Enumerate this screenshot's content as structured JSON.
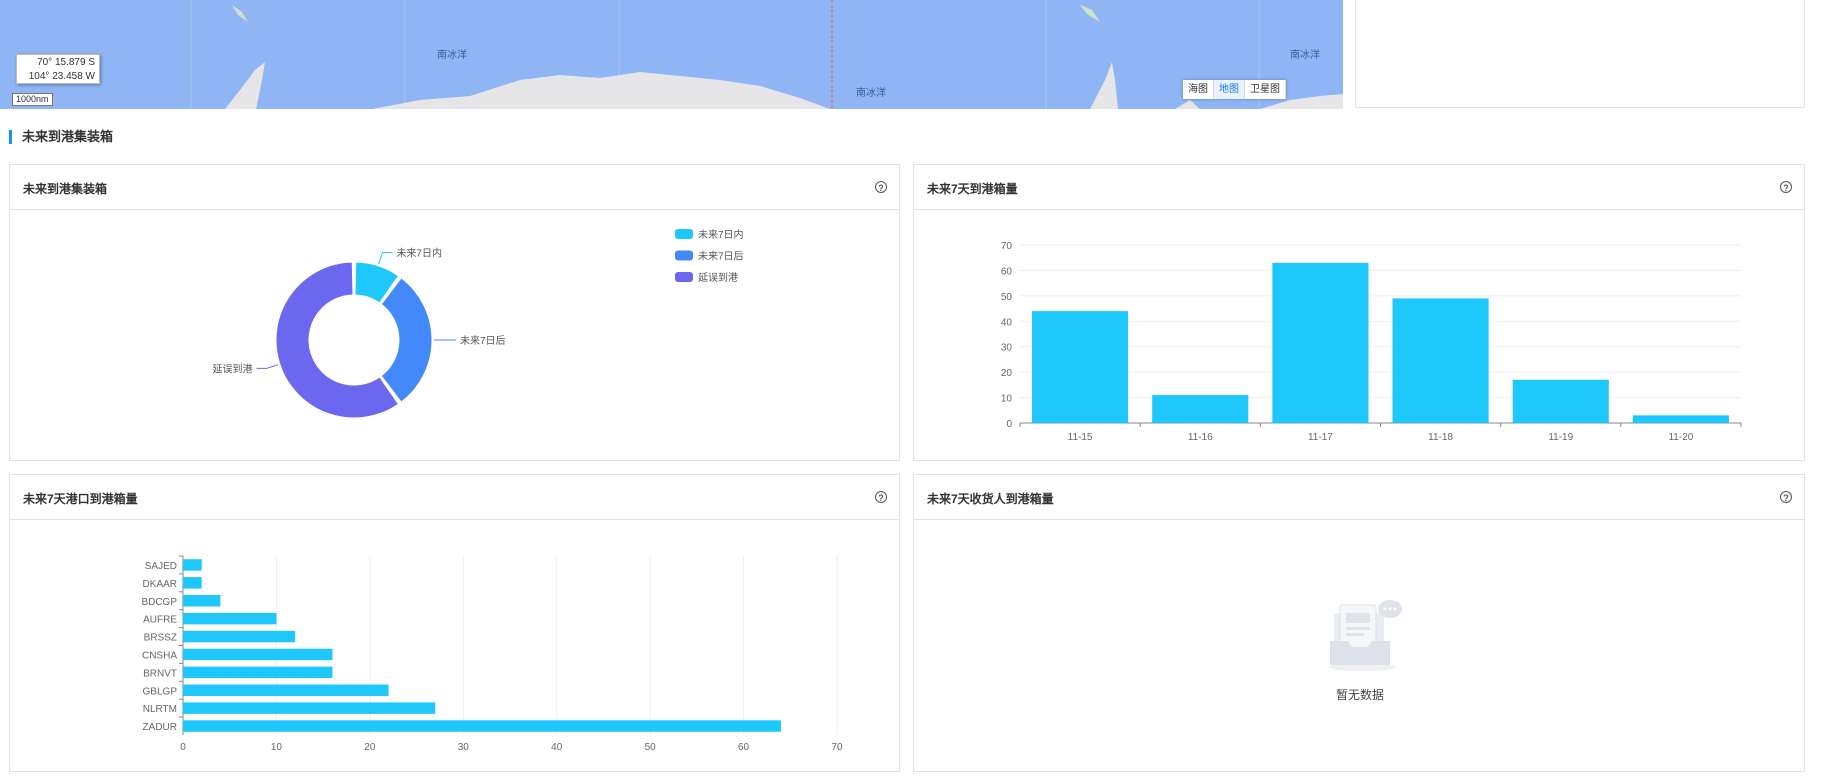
{
  "map": {
    "coord_lat": "70° 15.879 S",
    "coord_lon": "104° 23.458 W",
    "scale_label": "1000nm",
    "ocean_labels": [
      "南冰洋",
      "南冰洋",
      "南冰洋"
    ],
    "switch_options": [
      "海图",
      "地图",
      "卫星图"
    ],
    "switch_active": "地图"
  },
  "section": {
    "title": "未来到港集装箱"
  },
  "cards": {
    "donut": {
      "title": "未来到港集装箱"
    },
    "bar": {
      "title": "未来7天到港箱量"
    },
    "hbar": {
      "title": "未来7天港口到港箱量"
    },
    "empty": {
      "title": "未来7天收货人到港箱量",
      "empty_text": "暂无数据"
    }
  },
  "colors": {
    "accent": "#1890ff",
    "bar": "#1ec8fc",
    "donut": [
      "#1ec8fc",
      "#4389fb",
      "#6b67ee"
    ]
  },
  "chart_data": [
    {
      "type": "pie",
      "title": "未来到港集装箱",
      "labels": [
        "未来7日内",
        "未来7日后",
        "延误到港"
      ],
      "values": [
        10,
        30,
        60
      ],
      "legend": "top-right"
    },
    {
      "type": "bar",
      "title": "未来7天到港箱量",
      "categories": [
        "11-15",
        "11-16",
        "11-17",
        "11-18",
        "11-19",
        "11-20"
      ],
      "values": [
        44,
        11,
        63,
        49,
        17,
        3
      ],
      "ylim": [
        0,
        70
      ],
      "yticks": [
        0,
        10,
        20,
        30,
        40,
        50,
        60,
        70
      ],
      "grid": true
    },
    {
      "type": "bar",
      "orientation": "horizontal",
      "title": "未来7天港口到港箱量",
      "categories": [
        "SAJED",
        "DKAAR",
        "BDCGP",
        "AUFRE",
        "BRSSZ",
        "CNSHA",
        "BRNVT",
        "GBLGP",
        "NLRTM",
        "ZADUR"
      ],
      "values": [
        2,
        2,
        4,
        10,
        12,
        16,
        16,
        22,
        27,
        64
      ],
      "xlim": [
        0,
        70
      ],
      "xticks": [
        0,
        10,
        20,
        30,
        40,
        50,
        60,
        70
      ],
      "grid": true
    }
  ]
}
